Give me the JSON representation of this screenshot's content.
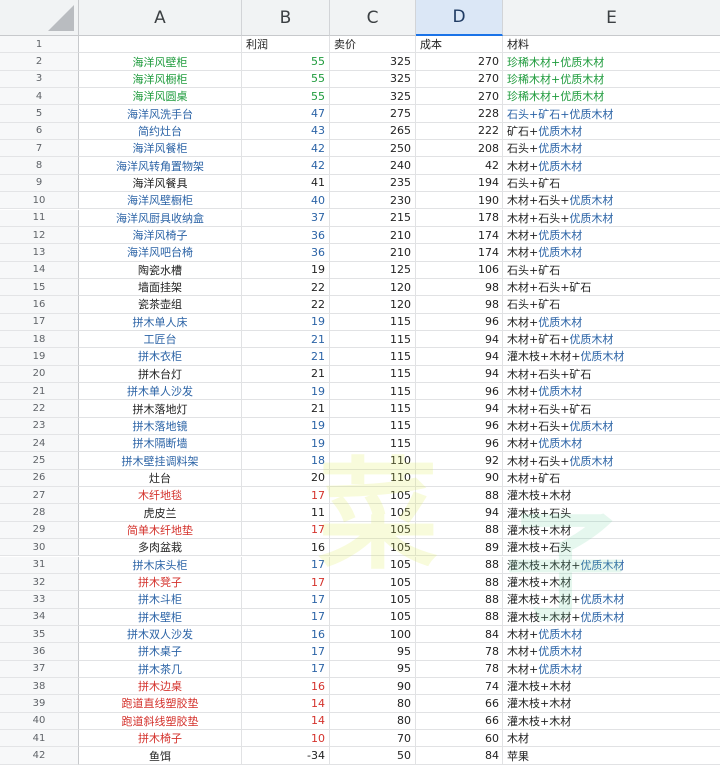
{
  "columns": [
    "A",
    "B",
    "C",
    "D",
    "E"
  ],
  "header_row": {
    "num": "1",
    "a": "",
    "b": "利润",
    "c": "卖价",
    "d": "成本",
    "e": "材料"
  },
  "watermark": [
    "菜",
    "子"
  ],
  "colors": {
    "green": "#1e9b3c",
    "blue": "#2b63a6",
    "red": "#d4322c",
    "black": "#222222",
    "selected_header": "#dbe7f6"
  },
  "rows": [
    {
      "num": "2",
      "name": "海洋风壁柜",
      "profit": "55",
      "price": "325",
      "cost": "270",
      "mat": [
        [
          "珍稀木材+优质木材",
          "green"
        ]
      ],
      "color": "green"
    },
    {
      "num": "3",
      "name": "海洋风橱柜",
      "profit": "55",
      "price": "325",
      "cost": "270",
      "mat": [
        [
          "珍稀木材+优质木材",
          "green"
        ]
      ],
      "color": "green"
    },
    {
      "num": "4",
      "name": "海洋风圆桌",
      "profit": "55",
      "price": "325",
      "cost": "270",
      "mat": [
        [
          "珍稀木材+优质木材",
          "green"
        ]
      ],
      "color": "green"
    },
    {
      "num": "5",
      "name": "海洋风洗手台",
      "profit": "47",
      "price": "275",
      "cost": "228",
      "mat": [
        [
          "石头+矿石+优质木材",
          "blue"
        ]
      ],
      "color": "blue"
    },
    {
      "num": "6",
      "name": "简约灶台",
      "profit": "43",
      "price": "265",
      "cost": "222",
      "mat": [
        [
          "矿石+",
          "black"
        ],
        [
          "优质木材",
          "blue"
        ]
      ],
      "color": "blue"
    },
    {
      "num": "7",
      "name": "海洋风餐柜",
      "profit": "42",
      "price": "250",
      "cost": "208",
      "mat": [
        [
          "石头+",
          "black"
        ],
        [
          "优质木材",
          "blue"
        ]
      ],
      "color": "blue"
    },
    {
      "num": "8",
      "name": "海洋风转角置物架",
      "profit": "42",
      "price": "240",
      "cost": "42",
      "mat": [
        [
          "木材+",
          "black"
        ],
        [
          "优质木材",
          "blue"
        ]
      ],
      "color": "blue"
    },
    {
      "num": "9",
      "name": "海洋风餐具",
      "profit": "41",
      "price": "235",
      "cost": "194",
      "mat": [
        [
          "石头+矿石",
          "black"
        ]
      ],
      "color": "black"
    },
    {
      "num": "10",
      "name": "海洋风壁橱柜",
      "profit": "40",
      "price": "230",
      "cost": "190",
      "mat": [
        [
          "木材+石头+",
          "black"
        ],
        [
          "优质木材",
          "blue"
        ]
      ],
      "color": "blue"
    },
    {
      "num": "11",
      "name": "海洋风厨具收纳盒",
      "profit": "37",
      "price": "215",
      "cost": "178",
      "mat": [
        [
          "木材+石头+",
          "black"
        ],
        [
          "优质木材",
          "blue"
        ]
      ],
      "color": "blue"
    },
    {
      "num": "12",
      "name": "海洋风椅子",
      "profit": "36",
      "price": "210",
      "cost": "174",
      "mat": [
        [
          "木材+",
          "black"
        ],
        [
          "优质木材",
          "blue"
        ]
      ],
      "color": "blue"
    },
    {
      "num": "13",
      "name": "海洋风吧台椅",
      "profit": "36",
      "price": "210",
      "cost": "174",
      "mat": [
        [
          "木材+",
          "black"
        ],
        [
          "优质木材",
          "blue"
        ]
      ],
      "color": "blue"
    },
    {
      "num": "14",
      "name": "陶瓷水槽",
      "profit": "19",
      "price": "125",
      "cost": "106",
      "mat": [
        [
          "石头+矿石",
          "black"
        ]
      ],
      "color": "black"
    },
    {
      "num": "15",
      "name": "墙面挂架",
      "profit": "22",
      "price": "120",
      "cost": "98",
      "mat": [
        [
          "木材+石头+矿石",
          "black"
        ]
      ],
      "color": "black"
    },
    {
      "num": "16",
      "name": "瓷茶壶组",
      "profit": "22",
      "price": "120",
      "cost": "98",
      "mat": [
        [
          "石头+矿石",
          "black"
        ]
      ],
      "color": "black"
    },
    {
      "num": "17",
      "name": "拼木单人床",
      "profit": "19",
      "price": "115",
      "cost": "96",
      "mat": [
        [
          "木材+",
          "black"
        ],
        [
          "优质木材",
          "blue"
        ]
      ],
      "color": "blue"
    },
    {
      "num": "18",
      "name": "工匠台",
      "profit": "21",
      "price": "115",
      "cost": "94",
      "mat": [
        [
          "木材+矿石+",
          "black"
        ],
        [
          "优质木材",
          "blue"
        ]
      ],
      "color": "blue"
    },
    {
      "num": "19",
      "name": "拼木衣柜",
      "profit": "21",
      "price": "115",
      "cost": "94",
      "mat": [
        [
          "灌木枝+木材+",
          "black"
        ],
        [
          "优质木材",
          "blue"
        ]
      ],
      "color": "blue"
    },
    {
      "num": "20",
      "name": "拼木台灯",
      "profit": "21",
      "price": "115",
      "cost": "94",
      "mat": [
        [
          "木材+石头+矿石",
          "black"
        ]
      ],
      "color": "black"
    },
    {
      "num": "21",
      "name": "拼木单人沙发",
      "profit": "19",
      "price": "115",
      "cost": "96",
      "mat": [
        [
          "木材+",
          "black"
        ],
        [
          "优质木材",
          "blue"
        ]
      ],
      "color": "blue"
    },
    {
      "num": "22",
      "name": "拼木落地灯",
      "profit": "21",
      "price": "115",
      "cost": "94",
      "mat": [
        [
          "木材+石头+矿石",
          "black"
        ]
      ],
      "color": "black"
    },
    {
      "num": "23",
      "name": "拼木落地镜",
      "profit": "19",
      "price": "115",
      "cost": "96",
      "mat": [
        [
          "木材+石头+",
          "black"
        ],
        [
          "优质木材",
          "blue"
        ]
      ],
      "color": "blue"
    },
    {
      "num": "24",
      "name": "拼木隔断墙",
      "profit": "19",
      "price": "115",
      "cost": "96",
      "mat": [
        [
          "木材+",
          "black"
        ],
        [
          "优质木材",
          "blue"
        ]
      ],
      "color": "blue"
    },
    {
      "num": "25",
      "name": "拼木壁挂调料架",
      "profit": "18",
      "price": "110",
      "cost": "92",
      "mat": [
        [
          "木材+石头+",
          "black"
        ],
        [
          "优质木材",
          "blue"
        ]
      ],
      "color": "blue"
    },
    {
      "num": "26",
      "name": "灶台",
      "profit": "20",
      "price": "110",
      "cost": "90",
      "mat": [
        [
          "木材+矿石",
          "black"
        ]
      ],
      "color": "black"
    },
    {
      "num": "27",
      "name": "木纤地毯",
      "profit": "17",
      "price": "105",
      "cost": "88",
      "mat": [
        [
          "灌木枝+木材",
          "black"
        ]
      ],
      "color": "red"
    },
    {
      "num": "28",
      "name": "虎皮兰",
      "profit": "11",
      "price": "105",
      "cost": "94",
      "mat": [
        [
          "灌木枝+石头",
          "black"
        ]
      ],
      "color": "black"
    },
    {
      "num": "29",
      "name": "简单木纤地垫",
      "profit": "17",
      "price": "105",
      "cost": "88",
      "mat": [
        [
          "灌木枝+木材",
          "black"
        ]
      ],
      "color": "red"
    },
    {
      "num": "30",
      "name": "多肉盆栽",
      "profit": "16",
      "price": "105",
      "cost": "89",
      "mat": [
        [
          "灌木枝+石头",
          "black"
        ]
      ],
      "color": "black"
    },
    {
      "num": "31",
      "name": "拼木床头柜",
      "profit": "17",
      "price": "105",
      "cost": "88",
      "mat": [
        [
          "灌木枝+木材+",
          "black"
        ],
        [
          "优质木材",
          "blue"
        ]
      ],
      "color": "blue"
    },
    {
      "num": "32",
      "name": "拼木凳子",
      "profit": "17",
      "price": "105",
      "cost": "88",
      "mat": [
        [
          "灌木枝+木材",
          "black"
        ]
      ],
      "color": "red"
    },
    {
      "num": "33",
      "name": "拼木斗柜",
      "profit": "17",
      "price": "105",
      "cost": "88",
      "mat": [
        [
          "灌木枝+木材+",
          "black"
        ],
        [
          "优质木材",
          "blue"
        ]
      ],
      "color": "blue"
    },
    {
      "num": "34",
      "name": "拼木壁柜",
      "profit": "17",
      "price": "105",
      "cost": "88",
      "mat": [
        [
          "灌木枝+木材+",
          "black"
        ],
        [
          "优质木材",
          "blue"
        ]
      ],
      "color": "blue"
    },
    {
      "num": "35",
      "name": "拼木双人沙发",
      "profit": "16",
      "price": "100",
      "cost": "84",
      "mat": [
        [
          "木材+",
          "black"
        ],
        [
          "优质木材",
          "blue"
        ]
      ],
      "color": "blue"
    },
    {
      "num": "36",
      "name": "拼木桌子",
      "profit": "17",
      "price": "95",
      "cost": "78",
      "mat": [
        [
          "木材+",
          "black"
        ],
        [
          "优质木材",
          "blue"
        ]
      ],
      "color": "blue"
    },
    {
      "num": "37",
      "name": "拼木茶几",
      "profit": "17",
      "price": "95",
      "cost": "78",
      "mat": [
        [
          "木材+",
          "black"
        ],
        [
          "优质木材",
          "blue"
        ]
      ],
      "color": "blue"
    },
    {
      "num": "38",
      "name": "拼木边桌",
      "profit": "16",
      "price": "90",
      "cost": "74",
      "mat": [
        [
          "灌木枝+木材",
          "black"
        ]
      ],
      "color": "red"
    },
    {
      "num": "39",
      "name": "跑道直线塑胶垫",
      "profit": "14",
      "price": "80",
      "cost": "66",
      "mat": [
        [
          "灌木枝+木材",
          "black"
        ]
      ],
      "color": "red"
    },
    {
      "num": "40",
      "name": "跑道斜线塑胶垫",
      "profit": "14",
      "price": "80",
      "cost": "66",
      "mat": [
        [
          "灌木枝+木材",
          "black"
        ]
      ],
      "color": "red"
    },
    {
      "num": "41",
      "name": "拼木椅子",
      "profit": "10",
      "price": "70",
      "cost": "60",
      "mat": [
        [
          "木材",
          "black"
        ]
      ],
      "color": "red"
    },
    {
      "num": "42",
      "name": "鱼饵",
      "profit": "-34",
      "price": "50",
      "cost": "84",
      "mat": [
        [
          "苹果",
          "black"
        ]
      ],
      "color": "black"
    }
  ]
}
